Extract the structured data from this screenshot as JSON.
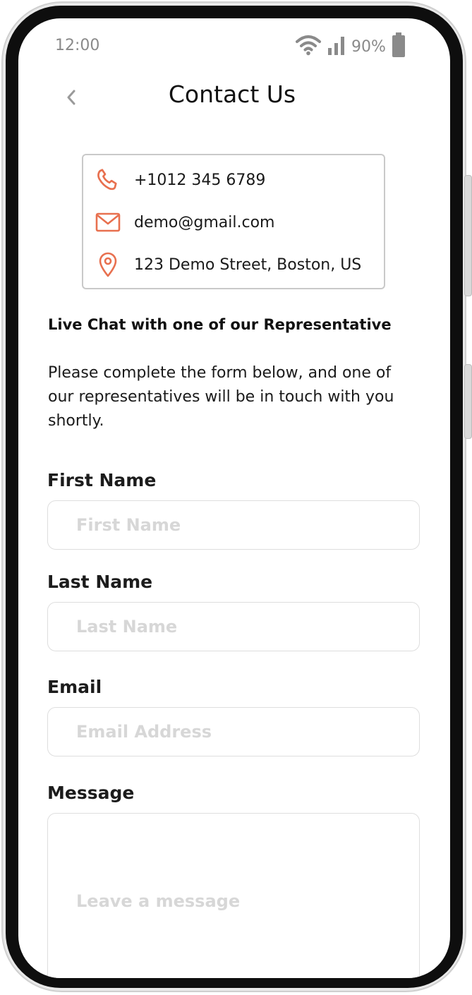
{
  "status_bar": {
    "time": "12:00",
    "battery": "90%"
  },
  "header": {
    "title": "Contact Us"
  },
  "contact_info": {
    "phone": "+1012 345 6789",
    "email": "demo@gmail.com",
    "address": "123 Demo Street, Boston, US"
  },
  "live_chat": {
    "title": "Live Chat with one of our Representative",
    "description": "Please complete the form below, and one of our representatives will be in touch with you shortly."
  },
  "form": {
    "first_name_label": "First Name",
    "first_name_placeholder": "First Name",
    "last_name_label": "Last Name",
    "last_name_placeholder": "Last Name",
    "email_label": "Email",
    "email_placeholder": "Email Address",
    "message_label": "Message",
    "message_placeholder": "Leave a message"
  },
  "colors": {
    "accent": "#e8704f",
    "label": "#1c1c1c",
    "placeholder": "#d7d7d7",
    "border": "#dedede"
  }
}
